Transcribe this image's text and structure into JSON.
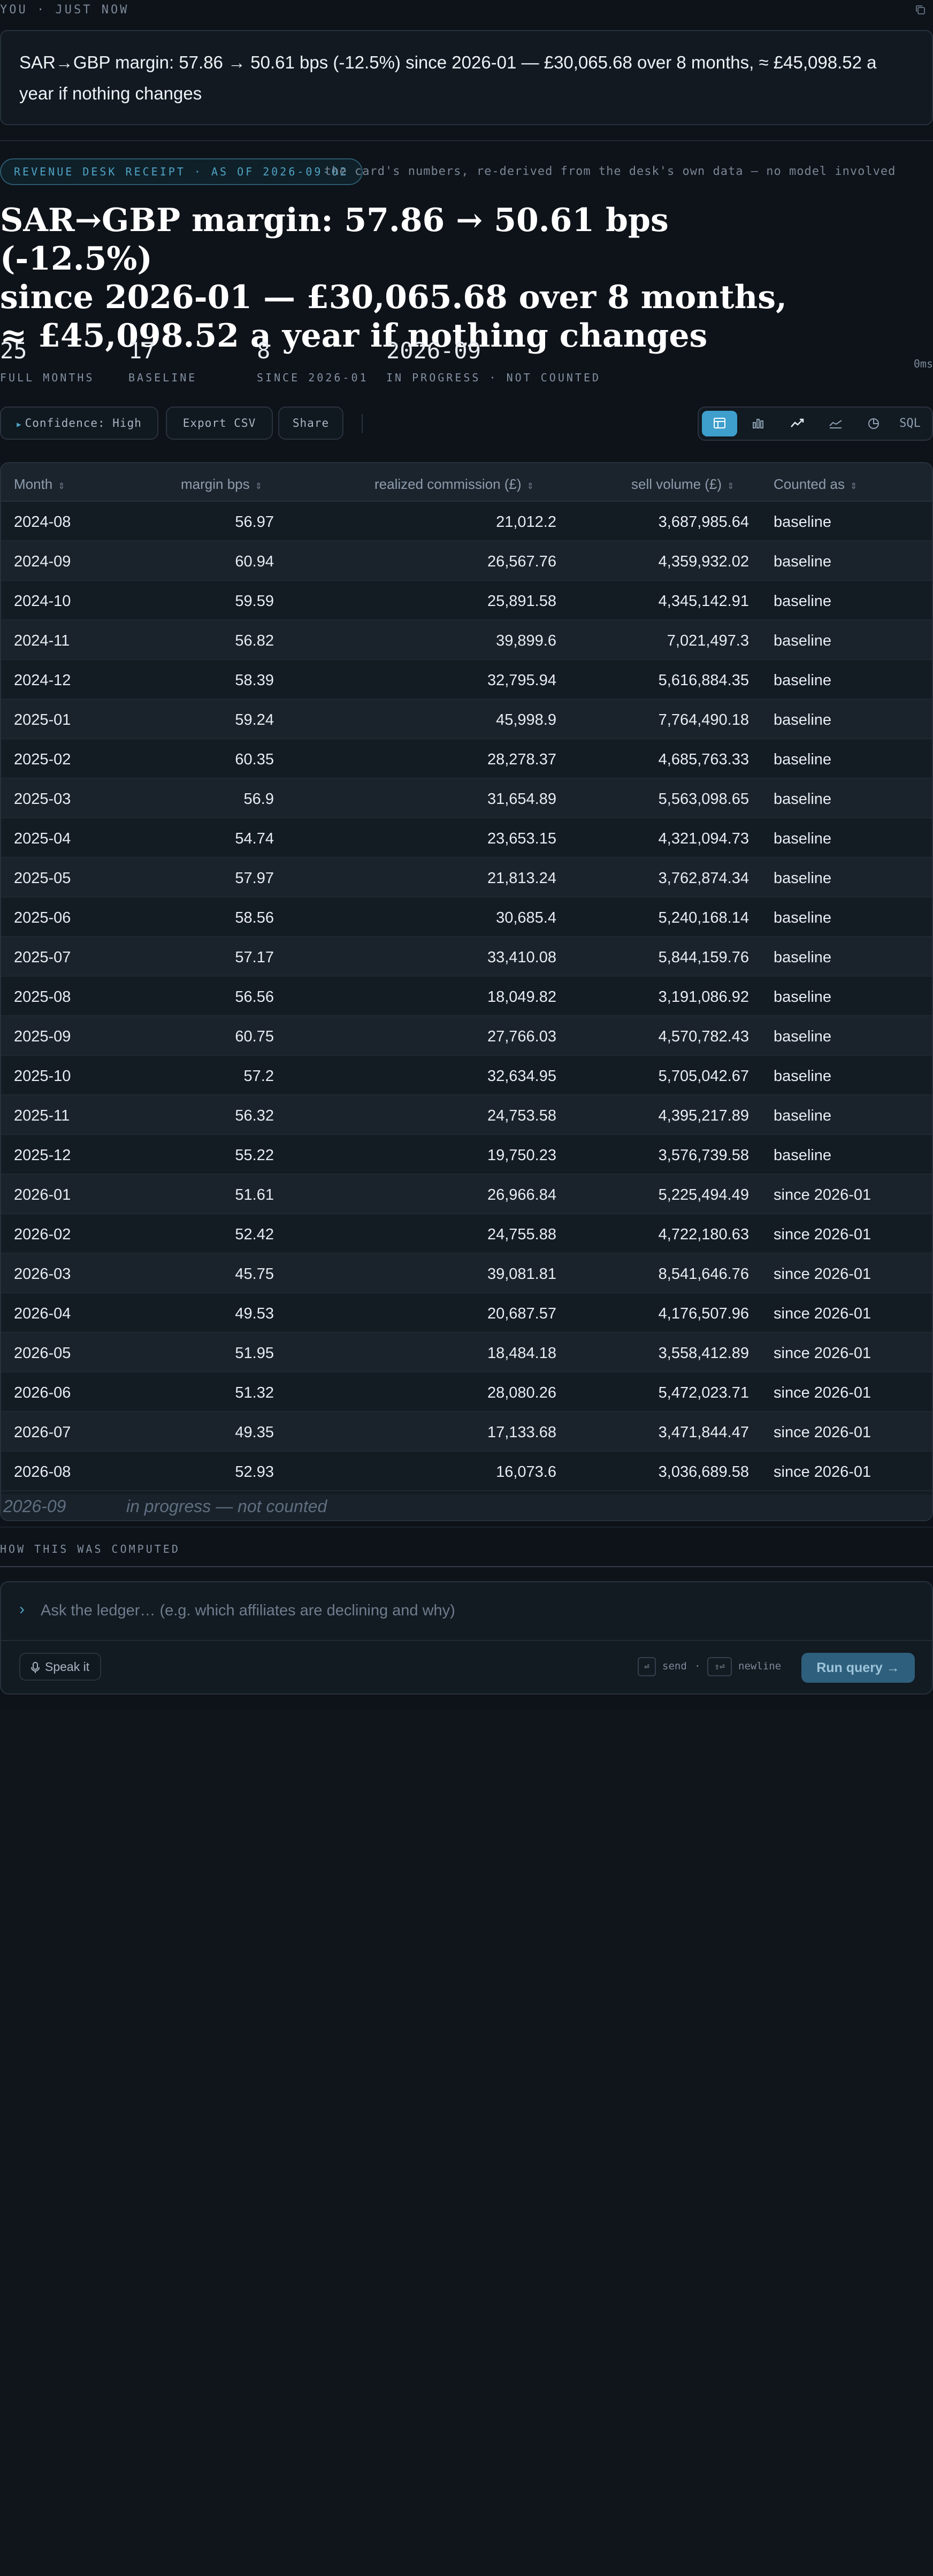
{
  "meta": {
    "you_label": "YOU · JUST NOW"
  },
  "user_message": "SAR→GBP margin: 57.86 → 50.61 bps (-12.5%) since 2026-01 — £30,065.68 over 8 months, ≈ £45,098.52 a year if nothing changes",
  "receipt": {
    "pill": "REVENUE DESK RECEIPT · AS OF 2026-09-02",
    "note": "the card's numbers, re-derived from the desk's own data — no model involved"
  },
  "headline": {
    "line1": "SAR→GBP margin: 57.86 → 50.61 bps (-12.5%)",
    "line2": "since 2026-01 — £30,065.68 over 8 months,",
    "line3": "≈ £45,098.52 a year if nothing changes"
  },
  "stats": [
    {
      "value": "25",
      "label": "FULL MONTHS"
    },
    {
      "value": "17",
      "label": "BASELINE"
    },
    {
      "value": "8",
      "label": "SINCE 2026-01"
    },
    {
      "value": "2026-09",
      "label": "IN PROGRESS · NOT COUNTED"
    }
  ],
  "timing": "0ms",
  "toolbar": {
    "confidence": "Confidence: High",
    "export": "Export CSV",
    "share": "Share",
    "sql": "SQL"
  },
  "table": {
    "columns": [
      "Month",
      "margin bps",
      "realized commission (£)",
      "sell volume (£)",
      "Counted as"
    ],
    "rows": [
      [
        "2024-08",
        "56.97",
        "21,012.2",
        "3,687,985.64",
        "baseline"
      ],
      [
        "2024-09",
        "60.94",
        "26,567.76",
        "4,359,932.02",
        "baseline"
      ],
      [
        "2024-10",
        "59.59",
        "25,891.58",
        "4,345,142.91",
        "baseline"
      ],
      [
        "2024-11",
        "56.82",
        "39,899.6",
        "7,021,497.3",
        "baseline"
      ],
      [
        "2024-12",
        "58.39",
        "32,795.94",
        "5,616,884.35",
        "baseline"
      ],
      [
        "2025-01",
        "59.24",
        "45,998.9",
        "7,764,490.18",
        "baseline"
      ],
      [
        "2025-02",
        "60.35",
        "28,278.37",
        "4,685,763.33",
        "baseline"
      ],
      [
        "2025-03",
        "56.9",
        "31,654.89",
        "5,563,098.65",
        "baseline"
      ],
      [
        "2025-04",
        "54.74",
        "23,653.15",
        "4,321,094.73",
        "baseline"
      ],
      [
        "2025-05",
        "57.97",
        "21,813.24",
        "3,762,874.34",
        "baseline"
      ],
      [
        "2025-06",
        "58.56",
        "30,685.4",
        "5,240,168.14",
        "baseline"
      ],
      [
        "2025-07",
        "57.17",
        "33,410.08",
        "5,844,159.76",
        "baseline"
      ],
      [
        "2025-08",
        "56.56",
        "18,049.82",
        "3,191,086.92",
        "baseline"
      ],
      [
        "2025-09",
        "60.75",
        "27,766.03",
        "4,570,782.43",
        "baseline"
      ],
      [
        "2025-10",
        "57.2",
        "32,634.95",
        "5,705,042.67",
        "baseline"
      ],
      [
        "2025-11",
        "56.32",
        "24,753.58",
        "4,395,217.89",
        "baseline"
      ],
      [
        "2025-12",
        "55.22",
        "19,750.23",
        "3,576,739.58",
        "baseline"
      ],
      [
        "2026-01",
        "51.61",
        "26,966.84",
        "5,225,494.49",
        "since 2026-01"
      ],
      [
        "2026-02",
        "52.42",
        "24,755.88",
        "4,722,180.63",
        "since 2026-01"
      ],
      [
        "2026-03",
        "45.75",
        "39,081.81",
        "8,541,646.76",
        "since 2026-01"
      ],
      [
        "2026-04",
        "49.53",
        "20,687.57",
        "4,176,507.96",
        "since 2026-01"
      ],
      [
        "2026-05",
        "51.95",
        "18,484.18",
        "3,558,412.89",
        "since 2026-01"
      ],
      [
        "2026-06",
        "51.32",
        "28,080.26",
        "5,472,023.71",
        "since 2026-01"
      ],
      [
        "2026-07",
        "49.35",
        "17,133.68",
        "3,471,844.47",
        "since 2026-01"
      ],
      [
        "2026-08",
        "52.93",
        "16,073.6",
        "3,036,689.58",
        "since 2026-01"
      ]
    ],
    "in_progress_month": "2026-09",
    "in_progress_note": "in progress — not counted"
  },
  "how_label": "HOW THIS WAS COMPUTED",
  "composer": {
    "placeholder": "Ask the ledger… (e.g. which affiliates are declining and why)",
    "speak": "Speak it",
    "send_hint": "send",
    "newline_hint": "newline",
    "run": "Run query"
  },
  "colors": {
    "accent": "#3e9fcc",
    "background": "#0e1219",
    "panel": "#131b23"
  }
}
